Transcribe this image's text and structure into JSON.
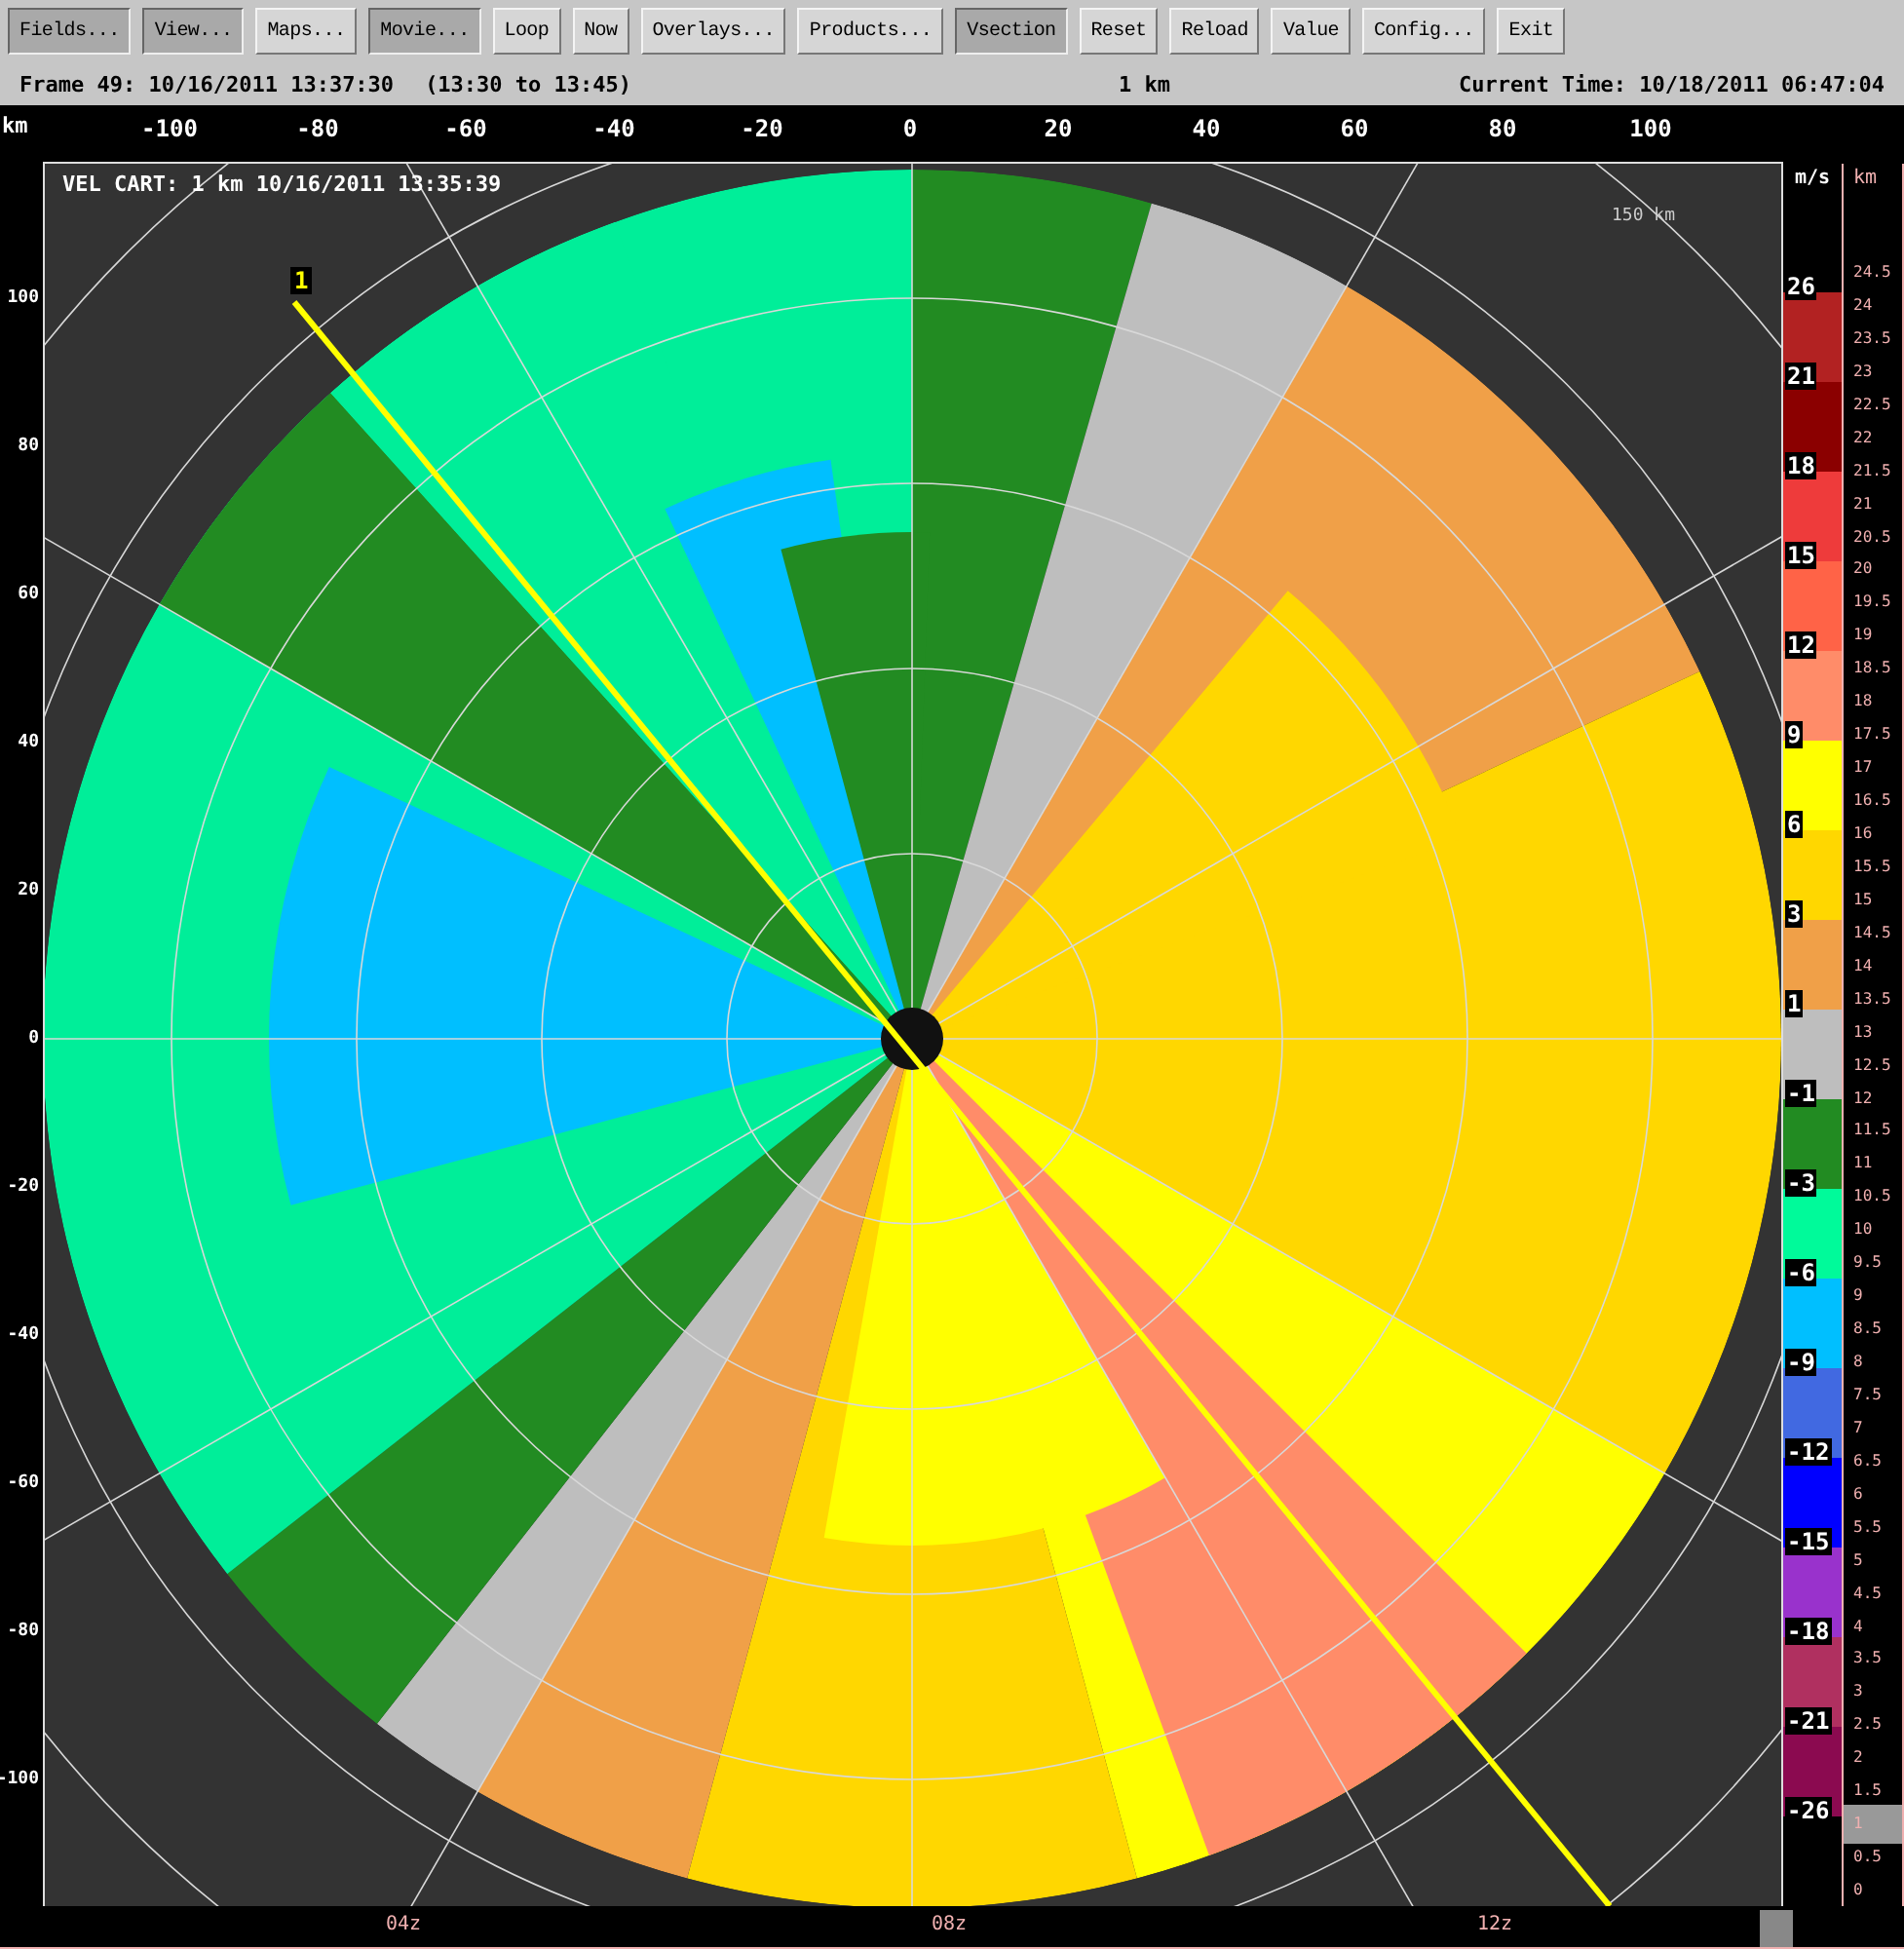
{
  "toolbar": {
    "buttons": [
      {
        "label": "Fields...",
        "pressed": true
      },
      {
        "label": "View...",
        "pressed": true
      },
      {
        "label": "Maps...",
        "pressed": false
      },
      {
        "label": "Movie...",
        "pressed": true
      },
      {
        "label": "Loop",
        "pressed": false
      },
      {
        "label": "Now",
        "pressed": false
      },
      {
        "label": "Overlays...",
        "pressed": false
      },
      {
        "label": "Products...",
        "pressed": false
      },
      {
        "label": "Vsection",
        "pressed": true
      },
      {
        "label": "Reset",
        "pressed": false
      },
      {
        "label": "Reload",
        "pressed": false
      },
      {
        "label": "Value",
        "pressed": false
      },
      {
        "label": "Config...",
        "pressed": false
      },
      {
        "label": "Exit",
        "pressed": false
      }
    ]
  },
  "status_bar": {
    "frame": "Frame 49: 10/16/2011 13:37:30",
    "time_range": "(13:30 to 13:45)",
    "resolution": "1 km",
    "current_time": "Current Time: 10/18/2011 06:47:04"
  },
  "plot": {
    "unit": "km",
    "x_ticks": [
      "-100",
      "-80",
      "-60",
      "-40",
      "-20",
      "0",
      "20",
      "40",
      "60",
      "80",
      "100"
    ],
    "y_ticks": [
      "100",
      "80",
      "60",
      "40",
      "20",
      "0",
      "-20",
      "-40",
      "-60",
      "-80",
      "-100"
    ],
    "title": "VEL CART: 1 km 10/16/2011 13:35:39",
    "ring_label": "150 km",
    "cross_section_label": "1"
  },
  "legend": {
    "unit": "m/s",
    "levels": [
      {
        "label": "26",
        "color": "#b22222"
      },
      {
        "label": "21",
        "color": "#8b0000"
      },
      {
        "label": "18",
        "color": "#ee3b3b"
      },
      {
        "label": "15",
        "color": "#ff6347"
      },
      {
        "label": "12",
        "color": "#ff8c69"
      },
      {
        "label": "9",
        "color": "#ffff00"
      },
      {
        "label": "6",
        "color": "#ffd700"
      },
      {
        "label": "3",
        "color": "#f0a048"
      },
      {
        "label": "1",
        "color": "#bebebe"
      },
      {
        "label": "-1",
        "color": "#228b22"
      },
      {
        "label": "-3",
        "color": "#00fa9a"
      },
      {
        "label": "-6",
        "color": "#00bfff"
      },
      {
        "label": "-9",
        "color": "#4169e1"
      },
      {
        "label": "-12",
        "color": "#0000ff"
      },
      {
        "label": "-15",
        "color": "#9932cc"
      },
      {
        "label": "-18",
        "color": "#b03060"
      },
      {
        "label": "-21",
        "color": "#8b0a50"
      },
      {
        "label": "-26"
      }
    ]
  },
  "height_scale": {
    "unit": "km",
    "ticks": [
      {
        "label": "24.5",
        "selected": false
      },
      {
        "label": "24",
        "selected": false
      },
      {
        "label": "23.5",
        "selected": false
      },
      {
        "label": "23",
        "selected": false
      },
      {
        "label": "22.5",
        "selected": false
      },
      {
        "label": "22",
        "selected": false
      },
      {
        "label": "21.5",
        "selected": false
      },
      {
        "label": "21",
        "selected": false
      },
      {
        "label": "20.5",
        "selected": false
      },
      {
        "label": "20",
        "selected": false
      },
      {
        "label": "19.5",
        "selected": false
      },
      {
        "label": "19",
        "selected": false
      },
      {
        "label": "18.5",
        "selected": false
      },
      {
        "label": "18",
        "selected": false
      },
      {
        "label": "17.5",
        "selected": false
      },
      {
        "label": "17",
        "selected": false
      },
      {
        "label": "16.5",
        "selected": false
      },
      {
        "label": "16",
        "selected": false
      },
      {
        "label": "15.5",
        "selected": false
      },
      {
        "label": "15",
        "selected": false
      },
      {
        "label": "14.5",
        "selected": false
      },
      {
        "label": "14",
        "selected": false
      },
      {
        "label": "13.5",
        "selected": false
      },
      {
        "label": "13",
        "selected": false
      },
      {
        "label": "12.5",
        "selected": false
      },
      {
        "label": "12",
        "selected": false
      },
      {
        "label": "11.5",
        "selected": false
      },
      {
        "label": "11",
        "selected": false
      },
      {
        "label": "10.5",
        "selected": false
      },
      {
        "label": "10",
        "selected": false
      },
      {
        "label": "9.5",
        "selected": false
      },
      {
        "label": "9",
        "selected": false
      },
      {
        "label": "8.5",
        "selected": false
      },
      {
        "label": "8",
        "selected": false
      },
      {
        "label": "7.5",
        "selected": false
      },
      {
        "label": "7",
        "selected": false
      },
      {
        "label": "6.5",
        "selected": false
      },
      {
        "label": "6",
        "selected": false
      },
      {
        "label": "5.5",
        "selected": false
      },
      {
        "label": "5",
        "selected": false
      },
      {
        "label": "4.5",
        "selected": false
      },
      {
        "label": "4",
        "selected": false
      },
      {
        "label": "3.5",
        "selected": false
      },
      {
        "label": "3",
        "selected": false
      },
      {
        "label": "2.5",
        "selected": false
      },
      {
        "label": "2",
        "selected": false
      },
      {
        "label": "1.5",
        "selected": false
      },
      {
        "label": "1",
        "selected": true
      },
      {
        "label": "0.5",
        "selected": false
      },
      {
        "label": "0",
        "selected": false
      }
    ]
  },
  "time_axis": {
    "labels": [
      "04z",
      "08z",
      "12z"
    ]
  }
}
